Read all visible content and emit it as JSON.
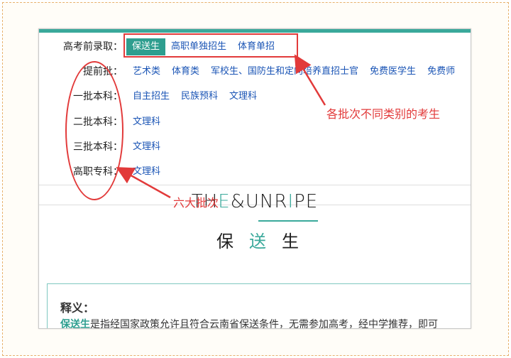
{
  "batch_rows": [
    {
      "label": "高考前录取：",
      "options": [
        {
          "text": "保送生",
          "active": true
        },
        {
          "text": "高职单独招生",
          "active": false
        },
        {
          "text": "体育单招",
          "active": false
        }
      ]
    },
    {
      "label": "提前批：",
      "options": [
        {
          "text": "艺术类",
          "active": false
        },
        {
          "text": "体育类",
          "active": false
        },
        {
          "text": "军校生、国防生和定向培养直招士官",
          "active": false
        },
        {
          "text": "免费医学生",
          "active": false
        },
        {
          "text": "免费师",
          "active": false
        }
      ]
    },
    {
      "label": "一批本科：",
      "options": [
        {
          "text": "自主招生",
          "active": false
        },
        {
          "text": "民族预科",
          "active": false
        },
        {
          "text": "文理科",
          "active": false
        }
      ]
    },
    {
      "label": "二批本科：",
      "options": [
        {
          "text": "文理科",
          "active": false
        }
      ]
    },
    {
      "label": "三批本科：",
      "options": [
        {
          "text": "文理科",
          "active": false
        }
      ]
    },
    {
      "label": "高职专科：",
      "options": [
        {
          "text": "文理科",
          "active": false
        }
      ]
    }
  ],
  "annotations": {
    "categories_note": "各批次不同类别的考生",
    "batches_note": "六大批次"
  },
  "brand": {
    "title_pre": "TH",
    "title_accent": "E",
    "title_mid": "&UNR",
    "title_accent2": "I",
    "title_post": "PE",
    "sub_1": "保",
    "sub_2": "送",
    "sub_3": "生"
  },
  "definition": {
    "title": "释义：",
    "term": "保送生",
    "text": "是指经国家政策允许且符合云南省保送条件，无需参加高考，经中学推荐，即可"
  },
  "colors": {
    "accent": "#3aa99b",
    "link": "#1a54b5",
    "annotation": "#e23a3a"
  }
}
